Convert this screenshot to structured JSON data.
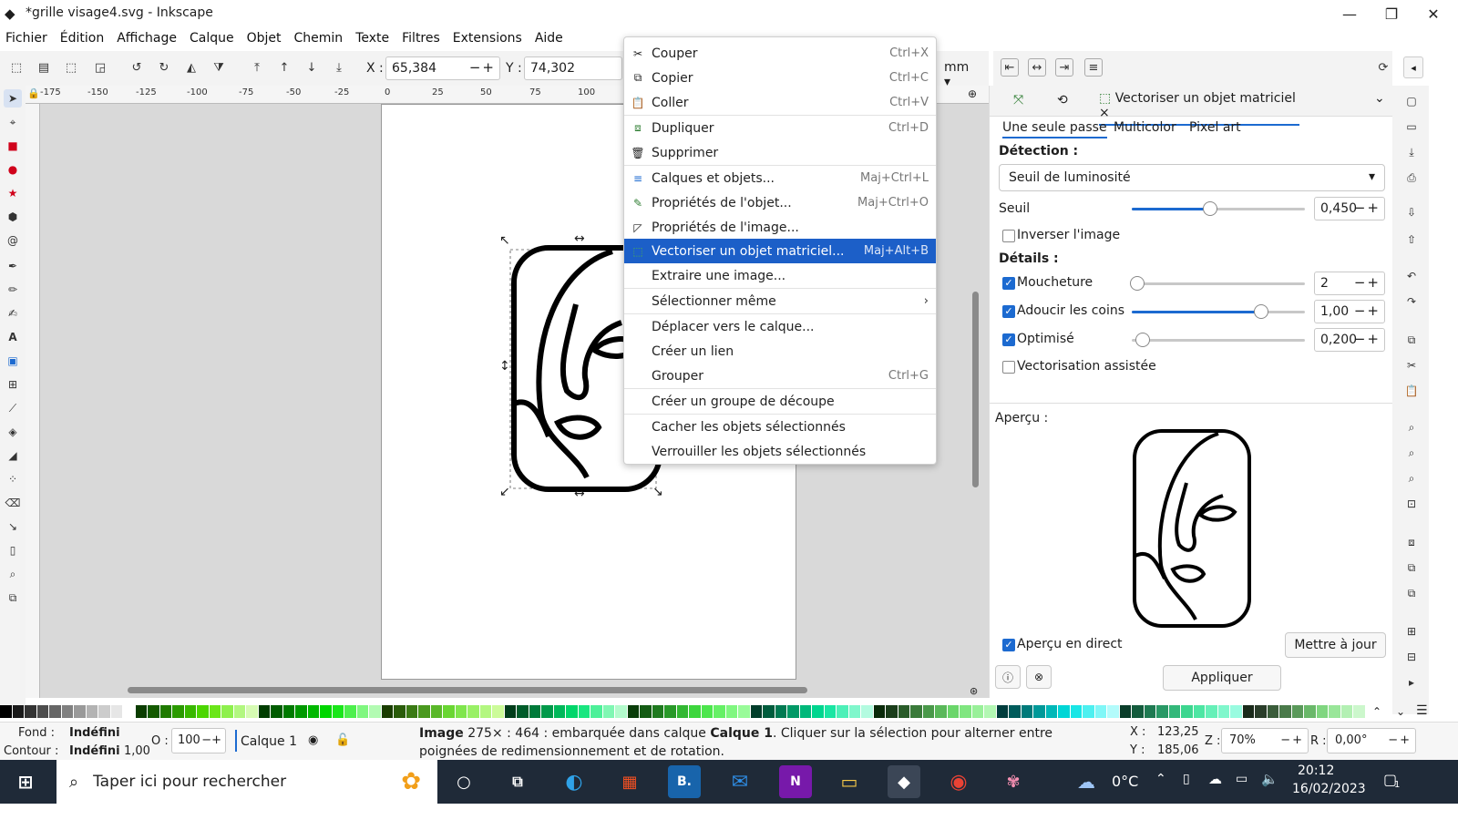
{
  "window": {
    "title": "*grille visage4.svg - Inkscape",
    "min": "—",
    "max": "❐",
    "close": "✕"
  },
  "menubar": [
    "Fichier",
    "Édition",
    "Affichage",
    "Calque",
    "Objet",
    "Chemin",
    "Texte",
    "Filtres",
    "Extensions",
    "Aide"
  ],
  "cmdbar": {
    "x_label": "X :",
    "x_value": "65,384",
    "y_label": "Y :",
    "y_value": "74,302",
    "unit": "mm"
  },
  "ruler": [
    "-175",
    "-150",
    "-125",
    "-100",
    "-75",
    "-50",
    "-25",
    "0",
    "25",
    "50",
    "75",
    "100"
  ],
  "context_menu": [
    {
      "icon": "✂",
      "label": "Couper",
      "shortcut": "Ctrl+X"
    },
    {
      "icon": "⧉",
      "label": "Copier",
      "shortcut": "Ctrl+C"
    },
    {
      "icon": "📋",
      "label": "Coller",
      "shortcut": "Ctrl+V"
    },
    {
      "icon": "⧈",
      "label": "Dupliquer",
      "shortcut": "Ctrl+D"
    },
    {
      "icon": "🗑",
      "label": "Supprimer",
      "shortcut": ""
    },
    {
      "icon": "≡",
      "label": "Calques et objets...",
      "shortcut": "Maj+Ctrl+L"
    },
    {
      "icon": "✎",
      "label": "Propriétés de l'objet...",
      "shortcut": "Maj+Ctrl+O"
    },
    {
      "icon": "◸",
      "label": "Propriétés de l'image...",
      "shortcut": ""
    },
    {
      "icon": "⬚",
      "label": "Vectoriser un objet matriciel...",
      "shortcut": "Maj+Alt+B"
    },
    {
      "icon": "",
      "label": "Extraire une image...",
      "shortcut": ""
    },
    {
      "icon": "",
      "label": "Sélectionner même",
      "shortcut": "›"
    },
    {
      "icon": "",
      "label": "Déplacer vers le calque...",
      "shortcut": ""
    },
    {
      "icon": "",
      "label": "Créer un lien",
      "shortcut": ""
    },
    {
      "icon": "",
      "label": "Grouper",
      "shortcut": "Ctrl+G"
    },
    {
      "icon": "",
      "label": "Créer un groupe de découpe",
      "shortcut": ""
    },
    {
      "icon": "",
      "label": "Cacher les objets sélectionnés",
      "shortcut": ""
    },
    {
      "icon": "",
      "label": "Verrouiller les objets sélectionnés",
      "shortcut": ""
    }
  ],
  "panel": {
    "tab_label": "Vectoriser un objet matriciel",
    "tab_close": "×",
    "subtabs": [
      "Une seule passe",
      "Multicolor",
      "Pixel art"
    ],
    "detection_label": "Détection :",
    "detection_value": "Seuil de luminosité",
    "seuil_label": "Seuil",
    "seuil_value": "0,450",
    "seuil_level": 0.45,
    "invert_label": "Inverser l'image",
    "details_label": "Détails :",
    "moucheture_label": "Moucheture",
    "moucheture_value": "2",
    "adoucir_label": "Adoucir les coins",
    "adoucir_value": "1,00",
    "optimise_label": "Optimisé",
    "optimise_value": "0,200",
    "assist_label": "Vectorisation assistée",
    "apercu_label": "Aperçu :",
    "live_label": "Aperçu en direct",
    "update_button": "Mettre à jour",
    "apply_button": "Appliquer"
  },
  "status": {
    "fill_label": "Fond :",
    "fill_value": "Indéfini",
    "stroke_label": "Contour :",
    "stroke_value": "Indéfini",
    "stroke_width": "1,00",
    "opacity_label": "O :",
    "opacity_value": "100",
    "layer": "Calque 1",
    "message_bold1": "Image",
    "message_mid": " 275× : 464 : embarquée dans calque ",
    "message_bold2": "Calque 1",
    "message_end": ". Cliquer sur la sélection pour alterner entre poignées de redimensionnement et de rotation.",
    "x_label": "X :",
    "x_value": "123,25",
    "y_label": "Y :",
    "y_value": "185,06",
    "z_label": "Z :",
    "zoom": "70%",
    "r_label": "R :",
    "rotation": "0,00°"
  },
  "taskbar": {
    "search_placeholder": "Taper ici pour rechercher",
    "weather": "0°C",
    "time": "20:12",
    "date": "16/02/2023",
    "notif": "1"
  }
}
